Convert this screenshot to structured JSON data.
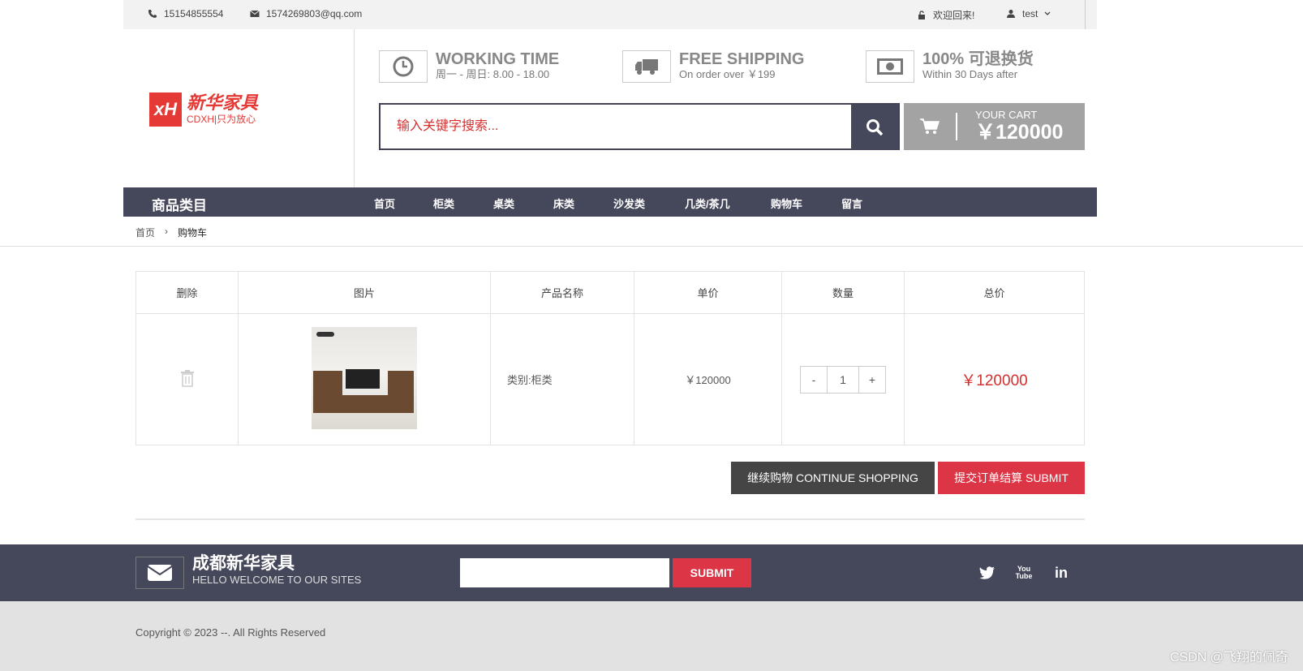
{
  "topbar": {
    "phone": "15154855554",
    "email": "1574269803@qq.com",
    "welcome": "欢迎回来!",
    "user": "test"
  },
  "logo": {
    "mark": "xH",
    "name": "新华家具",
    "sub": "CDXH|只为放心"
  },
  "features": [
    {
      "title": "WORKING TIME",
      "sub": "周一 - 周日: 8.00 - 18.00",
      "icon": "clock-icon"
    },
    {
      "title": "FREE SHIPPING",
      "sub": "On order over ￥199",
      "icon": "truck-icon"
    },
    {
      "title": "100% 可退换货",
      "sub": "Within 30 Days after",
      "icon": "money-icon"
    }
  ],
  "search": {
    "placeholder": "输入关键字搜索..."
  },
  "cart": {
    "label": "YOUR CART",
    "amount": "￥120000"
  },
  "nav": {
    "category": "商品类目",
    "links": [
      "首页",
      "柜类",
      "桌类",
      "床类",
      "沙发类",
      "几类/茶几",
      "购物车",
      "留言"
    ]
  },
  "breadcrumb": {
    "home": "首页",
    "current": "购物车"
  },
  "table": {
    "headers": [
      "删除",
      "图片",
      "产品名称",
      "单价",
      "数量",
      "总价"
    ],
    "rows": [
      {
        "name": "类别:柜类",
        "price": "￥120000",
        "qty": "1",
        "total": "￥120000"
      }
    ]
  },
  "actions": {
    "continue": "继续购物 CONTINUE SHOPPING",
    "submit": "提交订单结算 SUBMIT"
  },
  "footer": {
    "brand": "成都新华家具",
    "welcome": "HELLO WELCOME TO OUR SITES",
    "submit": "SUBMIT"
  },
  "copyright": "Copyright © 2023 --. All Rights Reserved",
  "watermark": "CSDN @飞翔的佩奇",
  "colors": {
    "accent": "#dc3545",
    "nav": "#45475a"
  }
}
